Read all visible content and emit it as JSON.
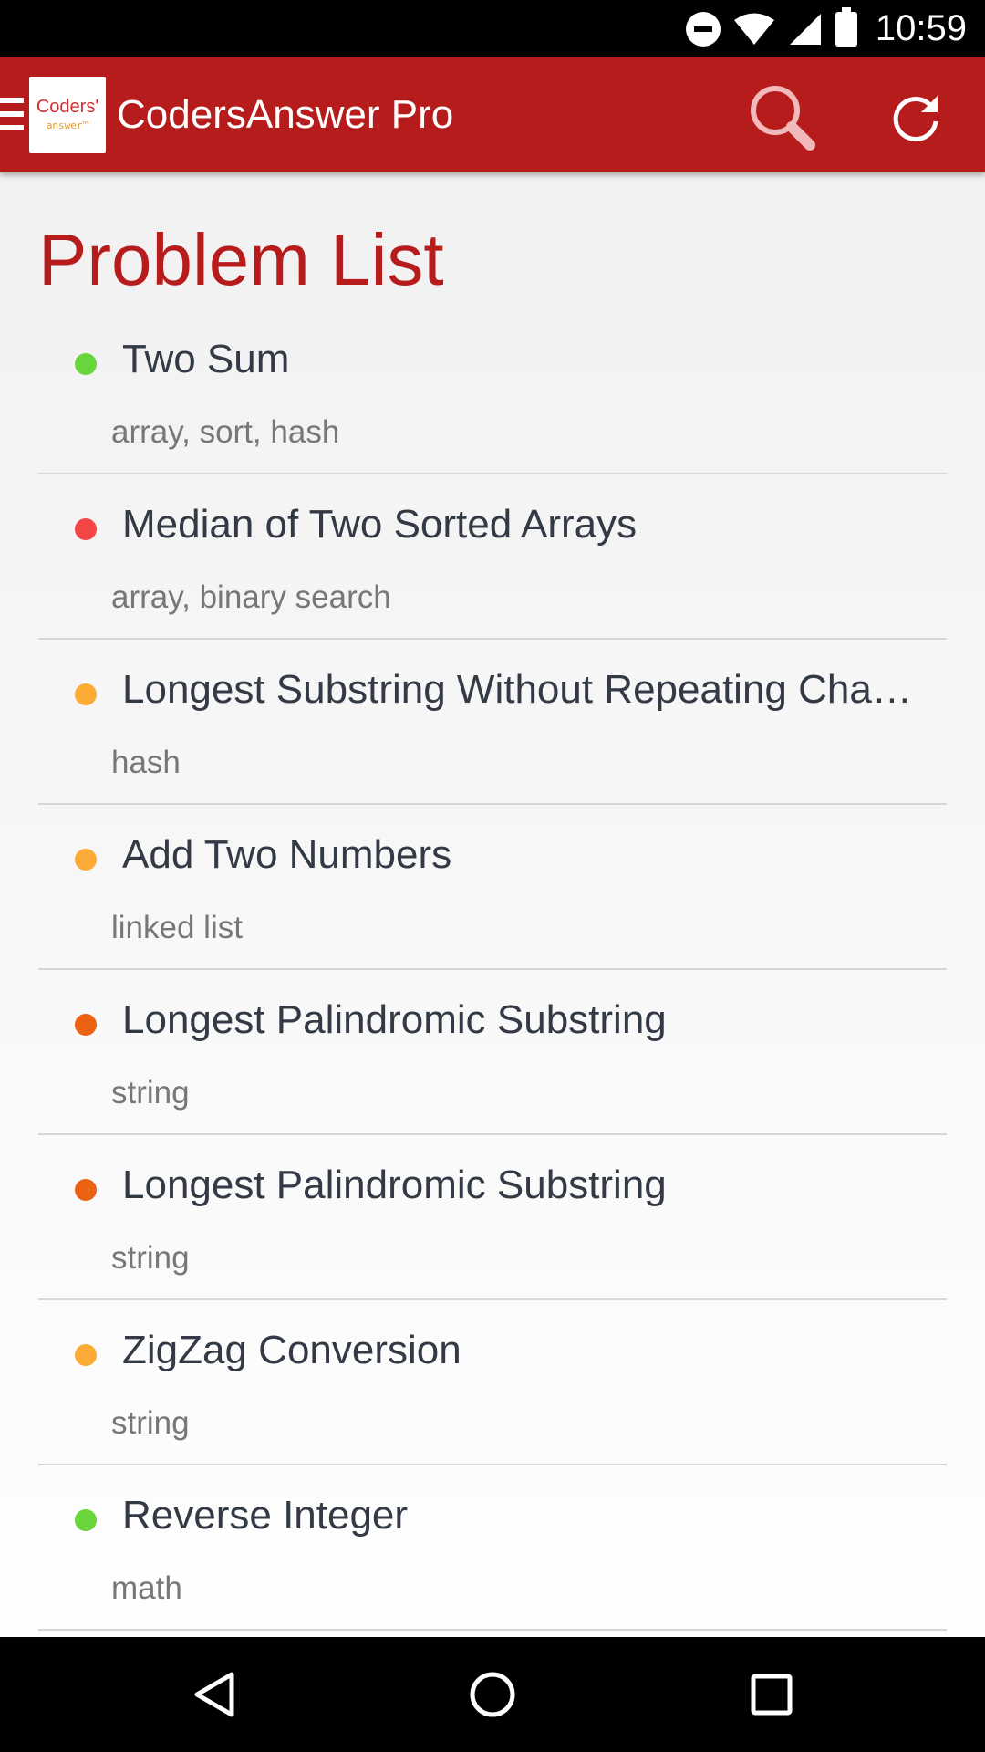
{
  "status_bar": {
    "time": "10:59",
    "icons": [
      "do-not-disturb-icon",
      "wifi-icon",
      "cell-signal-icon",
      "battery-icon"
    ]
  },
  "app_bar": {
    "title": "CodersAnswer Pro",
    "logo_top": "Coders'",
    "logo_bottom": "answer™",
    "icons": [
      "menu-icon",
      "search-icon",
      "refresh-icon"
    ]
  },
  "page": {
    "title": "Problem List"
  },
  "colors": {
    "accent": "#b71c1c",
    "easy": "#6ad43c",
    "hard": "#f44646",
    "medium": "#fbab36",
    "medium_hard": "#ea6212"
  },
  "problems": [
    {
      "title": "Two Sum",
      "tags": "array, sort, hash",
      "color": "#6ad43c"
    },
    {
      "title": "Median of Two Sorted Arrays",
      "tags": "array, binary search",
      "color": "#f44646"
    },
    {
      "title": "Longest Substring Without Repeating Char…",
      "tags": "hash",
      "color": "#fbab36"
    },
    {
      "title": "Add Two Numbers",
      "tags": "linked list",
      "color": "#fbab36"
    },
    {
      "title": "Longest Palindromic Substring",
      "tags": "string",
      "color": "#ea6212"
    },
    {
      "title": "Longest Palindromic Substring",
      "tags": "string",
      "color": "#ea6212"
    },
    {
      "title": "ZigZag Conversion",
      "tags": "string",
      "color": "#fbab36"
    },
    {
      "title": "Reverse Integer",
      "tags": "math",
      "color": "#6ad43c"
    }
  ],
  "nav_bar": {
    "icons": [
      "back-icon",
      "home-icon",
      "recent-apps-icon"
    ]
  }
}
